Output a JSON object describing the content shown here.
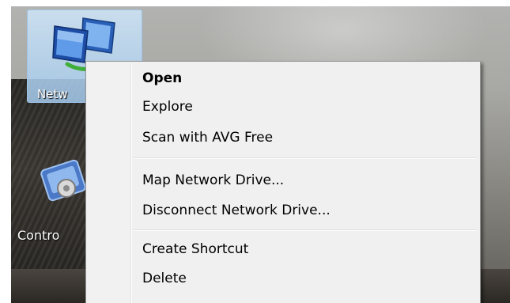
{
  "desktop": {
    "icons": [
      {
        "label": "Netw"
      },
      {
        "label": "Contro"
      }
    ]
  },
  "context_menu": {
    "groups": [
      [
        {
          "label": "Open",
          "default": true
        },
        {
          "label": "Explore"
        },
        {
          "label": "Scan with AVG Free"
        }
      ],
      [
        {
          "label": "Map Network Drive..."
        },
        {
          "label": "Disconnect Network Drive..."
        }
      ],
      [
        {
          "label": "Create Shortcut"
        },
        {
          "label": "Delete"
        }
      ]
    ]
  },
  "colors": {
    "menu_background": "#f0f0f0",
    "menu_border": "#979797",
    "selection_tile": "#bcd9f2"
  },
  "icon_names": [
    "network-icon",
    "control-panel-icon"
  ]
}
